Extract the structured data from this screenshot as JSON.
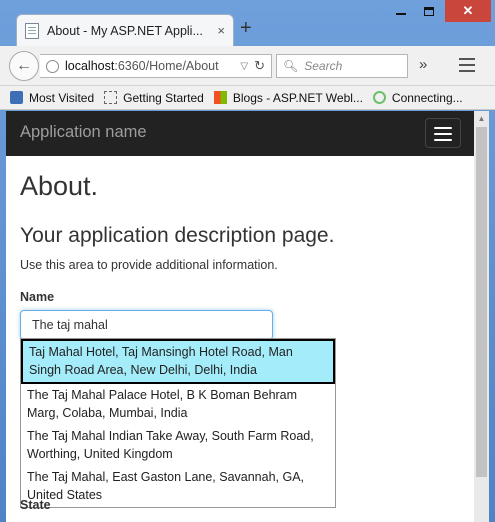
{
  "browser": {
    "tab_title": "About - My ASP.NET Appli...",
    "tab_close": "×",
    "new_tab": "+",
    "url_host": "localhost",
    "url_path": ":6360/Home/About",
    "search_placeholder": "Search",
    "overflow": "»",
    "bookmarks": [
      {
        "label": "Most Visited",
        "icon": "folder-icon"
      },
      {
        "label": "Getting Started",
        "icon": "page-icon"
      },
      {
        "label": "Blogs - ASP.NET Webl...",
        "icon": "microsoft-icon"
      },
      {
        "label": "Connecting...",
        "icon": "loading-icon"
      }
    ]
  },
  "site": {
    "brand": "Application name"
  },
  "page": {
    "title": "About.",
    "subtitle": "Your application description page.",
    "description": "Use this area to provide additional information.",
    "name_label": "Name",
    "name_value": "The taj mahal",
    "state_label": "State"
  },
  "suggestions": [
    "Taj Mahal Hotel, Taj Mansingh Hotel Road, Man Singh Road Area, New Delhi, Delhi, India",
    "The Taj Mahal Palace Hotel, B K Boman Behram Marg, Colaba, Mumbai, India",
    "The Taj Mahal Indian Take Away, South Farm Road, Worthing, United Kingdom",
    "The Taj Mahal, East Gaston Lane, Savannah, GA, United States"
  ],
  "colors": {
    "navbar_bg": "#222222",
    "highlight": "#a4ecfa",
    "close_button": "#c9463d"
  }
}
